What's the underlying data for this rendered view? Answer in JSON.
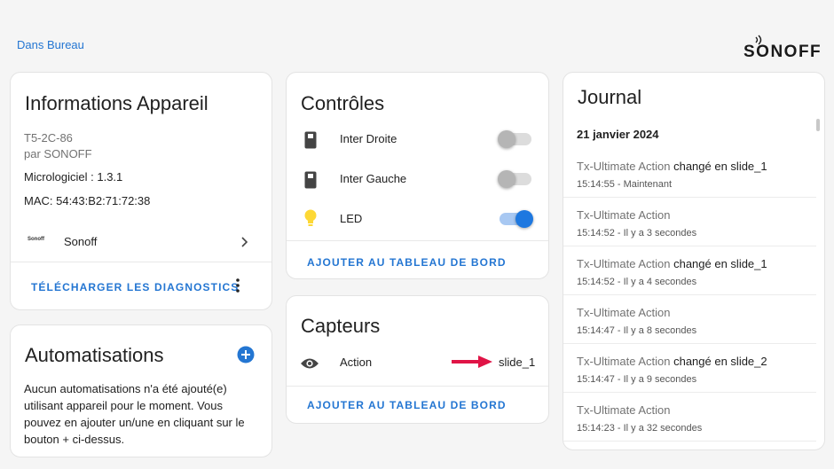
{
  "breadcrumb": {
    "area": "Dans Bureau"
  },
  "brand": {
    "name": "SONOFF"
  },
  "info": {
    "title": "Informations Appareil",
    "model": "T5-2C-86",
    "manufacturer": "par SONOFF",
    "firmware": "Micrologiciel : 1.3.1",
    "mac": "MAC: 54:43:B2:71:72:38",
    "integration": {
      "logo_text": "Sonoff",
      "label": "Sonoff"
    },
    "download_label": "TÉLÉCHARGER LES DIAGNOSTICS"
  },
  "automations": {
    "title": "Automatisations",
    "description": "Aucun automatisations n'a été ajouté(e) utilisant appareil pour le moment. Vous pouvez en ajouter un/une en cliquant sur le bouton + ci-dessus."
  },
  "controls": {
    "title": "Contrôles",
    "items": [
      {
        "label": "Inter Droite",
        "icon": "switch-icon",
        "state": "off"
      },
      {
        "label": "Inter Gauche",
        "icon": "switch-icon",
        "state": "off"
      },
      {
        "label": "LED",
        "icon": "lightbulb-icon",
        "state": "on"
      }
    ],
    "add_label": "AJOUTER AU TABLEAU DE BORD"
  },
  "sensors": {
    "title": "Capteurs",
    "items": [
      {
        "label": "Action",
        "icon": "eye-icon",
        "value": "slide_1"
      }
    ],
    "add_label": "AJOUTER AU TABLEAU DE BORD"
  },
  "journal": {
    "title": "Journal",
    "date": "21 janvier 2024",
    "entries": [
      {
        "entity": "Tx-Ultimate Action",
        "change": " changé en slide_1",
        "meta": "15:14:55 - Maintenant"
      },
      {
        "entity": "Tx-Ultimate Action",
        "change": "",
        "meta": "15:14:52 - Il y a 3 secondes"
      },
      {
        "entity": "Tx-Ultimate Action",
        "change": " changé en slide_1",
        "meta": "15:14:52 - Il y a 4 secondes"
      },
      {
        "entity": "Tx-Ultimate Action",
        "change": "",
        "meta": "15:14:47 - Il y a 8 secondes"
      },
      {
        "entity": "Tx-Ultimate Action",
        "change": " changé en slide_2",
        "meta": "15:14:47 - Il y a 9 secondes"
      },
      {
        "entity": "Tx-Ultimate Action",
        "change": "",
        "meta": "15:14:23 - Il y a 32 secondes"
      }
    ]
  },
  "colors": {
    "accent": "#2476d2",
    "toggle_on": "#1e78e0",
    "led": "#fdd835",
    "arrow": "#e01446"
  }
}
